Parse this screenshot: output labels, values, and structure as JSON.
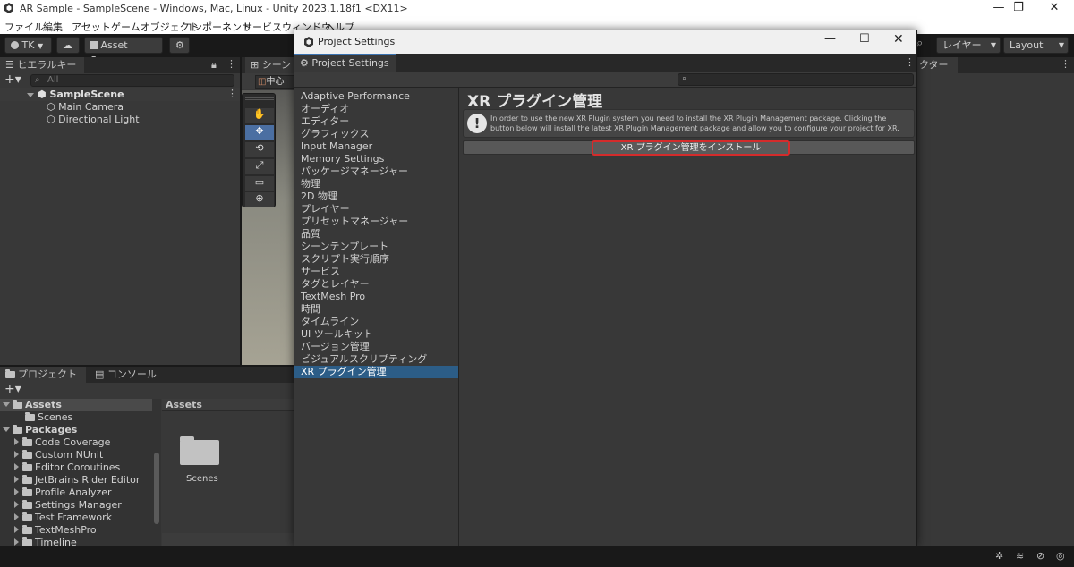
{
  "window": {
    "title": "AR Sample - SampleScene - Windows, Mac, Linux - Unity 2023.1.18f1 <DX11>",
    "minimize": "—",
    "maximize": "❐",
    "close": "✕"
  },
  "menu": [
    "ファイル",
    "編集",
    "アセット",
    "ゲームオブジェクト",
    "コンポーネント",
    "サービス",
    "ウィンドウ",
    "ヘルプ"
  ],
  "toolbar": {
    "account": "TK",
    "asset_store": "Asset Store",
    "layers": "レイヤー",
    "layout": "Layout"
  },
  "hierarchy": {
    "tab": "ヒエラルキー",
    "search_placeholder": "All",
    "scene": "SampleScene",
    "items": [
      "Main Camera",
      "Directional Light"
    ]
  },
  "scene_view": {
    "tab": "シーン",
    "pivot": "中心"
  },
  "inspector_tab": "クター",
  "project": {
    "tab_project": "プロジェクト",
    "tab_console": "コンソール",
    "tree_assets": "Assets",
    "tree_scenes": "Scenes",
    "tree_packages": "Packages",
    "packages": [
      "Code Coverage",
      "Custom NUnit",
      "Editor Coroutines",
      "JetBrains Rider Editor",
      "Profile Analyzer",
      "Settings Manager",
      "Test Framework",
      "TextMeshPro",
      "Timeline"
    ],
    "breadcrumb": "Assets",
    "folder_label": "Scenes"
  },
  "modal": {
    "title": "Project Settings",
    "tab": "Project Settings",
    "categories": [
      "Adaptive Performance",
      "オーディオ",
      "エディター",
      "グラフィックス",
      "Input Manager",
      "Memory Settings",
      "パッケージマネージャー",
      "物理",
      "2D 物理",
      "プレイヤー",
      "プリセットマネージャー",
      "品質",
      "シーンテンプレート",
      "スクリプト実行順序",
      "サービス",
      "タグとレイヤー",
      "TextMesh Pro",
      "時間",
      "タイムライン",
      "UI ツールキット",
      "バージョン管理",
      "ビジュアルスクリプティング",
      "XR プラグイン管理"
    ],
    "selected_index": 22,
    "heading": "XR プラグイン管理",
    "info_line1": "In order to use the new XR Plugin system you need to install the XR Plugin Management package. Clicking the",
    "info_line2": "button below will install the latest XR Plugin Management package and allow you to configure your project for XR.",
    "install_button": "XR プラグイン管理をインストール"
  },
  "colors": {
    "highlight": "#d42b2b",
    "selection": "#2c5d87"
  }
}
